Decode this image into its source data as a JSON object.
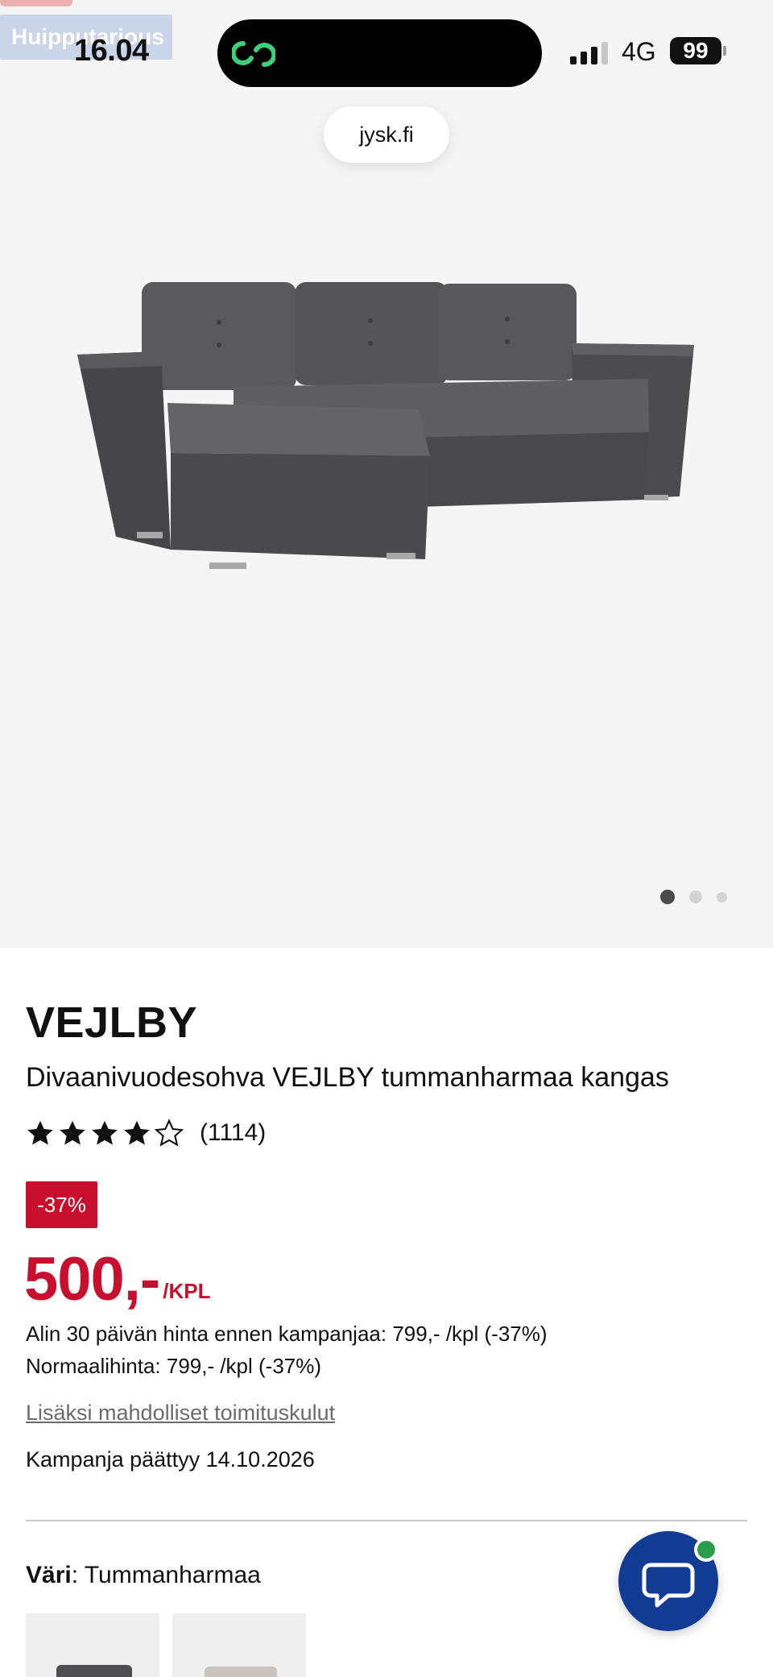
{
  "status_bar": {
    "time": "16.04",
    "network": "4G",
    "battery": "99"
  },
  "browser": {
    "url": "jysk.fi"
  },
  "overlay_ribbon": "Huipputarjous",
  "hero": {
    "image": "sofa-image",
    "carousel_dots": 3,
    "active_dot": 1
  },
  "product": {
    "brand": "VEJLBY",
    "title": "Divaanivuodesohva VEJLBY tummanharmaa kangas",
    "rating": 4,
    "rating_max": 5,
    "review_count": "(1114)",
    "discount_badge": "-37%",
    "price": "500,-",
    "price_unit": "/KPL",
    "lowest_price_30d": "Alin 30 päivän hinta ennen kampanjaa: 799,- /kpl (-37%)",
    "normal_price": "Normaalihinta: 799,- /kpl (-37%)",
    "shipping_link": "Lisäksi mahdolliset toimituskulut",
    "campaign_end": "Kampanja päättyy 14.10.2026",
    "color_label": "Väri",
    "color_value": ": Tummanharmaa"
  },
  "colors": {
    "accent_red": "#c8102e",
    "chat_blue": "#123b94",
    "online_green": "#2a9d4a"
  },
  "chat": {
    "icon": "chat-bubble-icon"
  }
}
